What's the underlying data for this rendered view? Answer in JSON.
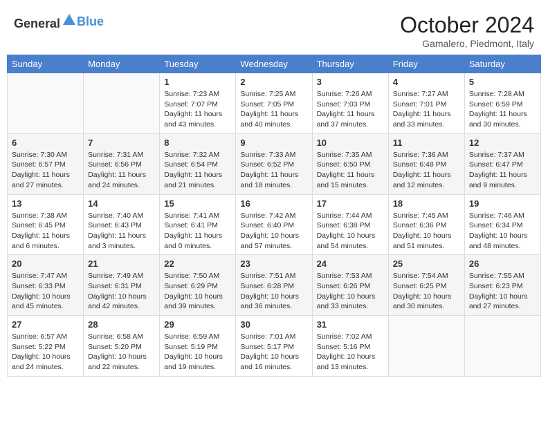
{
  "logo": {
    "text_general": "General",
    "text_blue": "Blue"
  },
  "header": {
    "title": "October 2024",
    "subtitle": "Gamalero, Piedmont, Italy"
  },
  "weekdays": [
    "Sunday",
    "Monday",
    "Tuesday",
    "Wednesday",
    "Thursday",
    "Friday",
    "Saturday"
  ],
  "weeks": [
    [
      {
        "day": "",
        "sunrise": "",
        "sunset": "",
        "daylight": ""
      },
      {
        "day": "",
        "sunrise": "",
        "sunset": "",
        "daylight": ""
      },
      {
        "day": "1",
        "sunrise": "Sunrise: 7:23 AM",
        "sunset": "Sunset: 7:07 PM",
        "daylight": "Daylight: 11 hours and 43 minutes."
      },
      {
        "day": "2",
        "sunrise": "Sunrise: 7:25 AM",
        "sunset": "Sunset: 7:05 PM",
        "daylight": "Daylight: 11 hours and 40 minutes."
      },
      {
        "day": "3",
        "sunrise": "Sunrise: 7:26 AM",
        "sunset": "Sunset: 7:03 PM",
        "daylight": "Daylight: 11 hours and 37 minutes."
      },
      {
        "day": "4",
        "sunrise": "Sunrise: 7:27 AM",
        "sunset": "Sunset: 7:01 PM",
        "daylight": "Daylight: 11 hours and 33 minutes."
      },
      {
        "day": "5",
        "sunrise": "Sunrise: 7:28 AM",
        "sunset": "Sunset: 6:59 PM",
        "daylight": "Daylight: 11 hours and 30 minutes."
      }
    ],
    [
      {
        "day": "6",
        "sunrise": "Sunrise: 7:30 AM",
        "sunset": "Sunset: 6:57 PM",
        "daylight": "Daylight: 11 hours and 27 minutes."
      },
      {
        "day": "7",
        "sunrise": "Sunrise: 7:31 AM",
        "sunset": "Sunset: 6:56 PM",
        "daylight": "Daylight: 11 hours and 24 minutes."
      },
      {
        "day": "8",
        "sunrise": "Sunrise: 7:32 AM",
        "sunset": "Sunset: 6:54 PM",
        "daylight": "Daylight: 11 hours and 21 minutes."
      },
      {
        "day": "9",
        "sunrise": "Sunrise: 7:33 AM",
        "sunset": "Sunset: 6:52 PM",
        "daylight": "Daylight: 11 hours and 18 minutes."
      },
      {
        "day": "10",
        "sunrise": "Sunrise: 7:35 AM",
        "sunset": "Sunset: 6:50 PM",
        "daylight": "Daylight: 11 hours and 15 minutes."
      },
      {
        "day": "11",
        "sunrise": "Sunrise: 7:36 AM",
        "sunset": "Sunset: 6:48 PM",
        "daylight": "Daylight: 11 hours and 12 minutes."
      },
      {
        "day": "12",
        "sunrise": "Sunrise: 7:37 AM",
        "sunset": "Sunset: 6:47 PM",
        "daylight": "Daylight: 11 hours and 9 minutes."
      }
    ],
    [
      {
        "day": "13",
        "sunrise": "Sunrise: 7:38 AM",
        "sunset": "Sunset: 6:45 PM",
        "daylight": "Daylight: 11 hours and 6 minutes."
      },
      {
        "day": "14",
        "sunrise": "Sunrise: 7:40 AM",
        "sunset": "Sunset: 6:43 PM",
        "daylight": "Daylight: 11 hours and 3 minutes."
      },
      {
        "day": "15",
        "sunrise": "Sunrise: 7:41 AM",
        "sunset": "Sunset: 6:41 PM",
        "daylight": "Daylight: 11 hours and 0 minutes."
      },
      {
        "day": "16",
        "sunrise": "Sunrise: 7:42 AM",
        "sunset": "Sunset: 6:40 PM",
        "daylight": "Daylight: 10 hours and 57 minutes."
      },
      {
        "day": "17",
        "sunrise": "Sunrise: 7:44 AM",
        "sunset": "Sunset: 6:38 PM",
        "daylight": "Daylight: 10 hours and 54 minutes."
      },
      {
        "day": "18",
        "sunrise": "Sunrise: 7:45 AM",
        "sunset": "Sunset: 6:36 PM",
        "daylight": "Daylight: 10 hours and 51 minutes."
      },
      {
        "day": "19",
        "sunrise": "Sunrise: 7:46 AM",
        "sunset": "Sunset: 6:34 PM",
        "daylight": "Daylight: 10 hours and 48 minutes."
      }
    ],
    [
      {
        "day": "20",
        "sunrise": "Sunrise: 7:47 AM",
        "sunset": "Sunset: 6:33 PM",
        "daylight": "Daylight: 10 hours and 45 minutes."
      },
      {
        "day": "21",
        "sunrise": "Sunrise: 7:49 AM",
        "sunset": "Sunset: 6:31 PM",
        "daylight": "Daylight: 10 hours and 42 minutes."
      },
      {
        "day": "22",
        "sunrise": "Sunrise: 7:50 AM",
        "sunset": "Sunset: 6:29 PM",
        "daylight": "Daylight: 10 hours and 39 minutes."
      },
      {
        "day": "23",
        "sunrise": "Sunrise: 7:51 AM",
        "sunset": "Sunset: 6:28 PM",
        "daylight": "Daylight: 10 hours and 36 minutes."
      },
      {
        "day": "24",
        "sunrise": "Sunrise: 7:53 AM",
        "sunset": "Sunset: 6:26 PM",
        "daylight": "Daylight: 10 hours and 33 minutes."
      },
      {
        "day": "25",
        "sunrise": "Sunrise: 7:54 AM",
        "sunset": "Sunset: 6:25 PM",
        "daylight": "Daylight: 10 hours and 30 minutes."
      },
      {
        "day": "26",
        "sunrise": "Sunrise: 7:55 AM",
        "sunset": "Sunset: 6:23 PM",
        "daylight": "Daylight: 10 hours and 27 minutes."
      }
    ],
    [
      {
        "day": "27",
        "sunrise": "Sunrise: 6:57 AM",
        "sunset": "Sunset: 5:22 PM",
        "daylight": "Daylight: 10 hours and 24 minutes."
      },
      {
        "day": "28",
        "sunrise": "Sunrise: 6:58 AM",
        "sunset": "Sunset: 5:20 PM",
        "daylight": "Daylight: 10 hours and 22 minutes."
      },
      {
        "day": "29",
        "sunrise": "Sunrise: 6:59 AM",
        "sunset": "Sunset: 5:19 PM",
        "daylight": "Daylight: 10 hours and 19 minutes."
      },
      {
        "day": "30",
        "sunrise": "Sunrise: 7:01 AM",
        "sunset": "Sunset: 5:17 PM",
        "daylight": "Daylight: 10 hours and 16 minutes."
      },
      {
        "day": "31",
        "sunrise": "Sunrise: 7:02 AM",
        "sunset": "Sunset: 5:16 PM",
        "daylight": "Daylight: 10 hours and 13 minutes."
      },
      {
        "day": "",
        "sunrise": "",
        "sunset": "",
        "daylight": ""
      },
      {
        "day": "",
        "sunrise": "",
        "sunset": "",
        "daylight": ""
      }
    ]
  ]
}
